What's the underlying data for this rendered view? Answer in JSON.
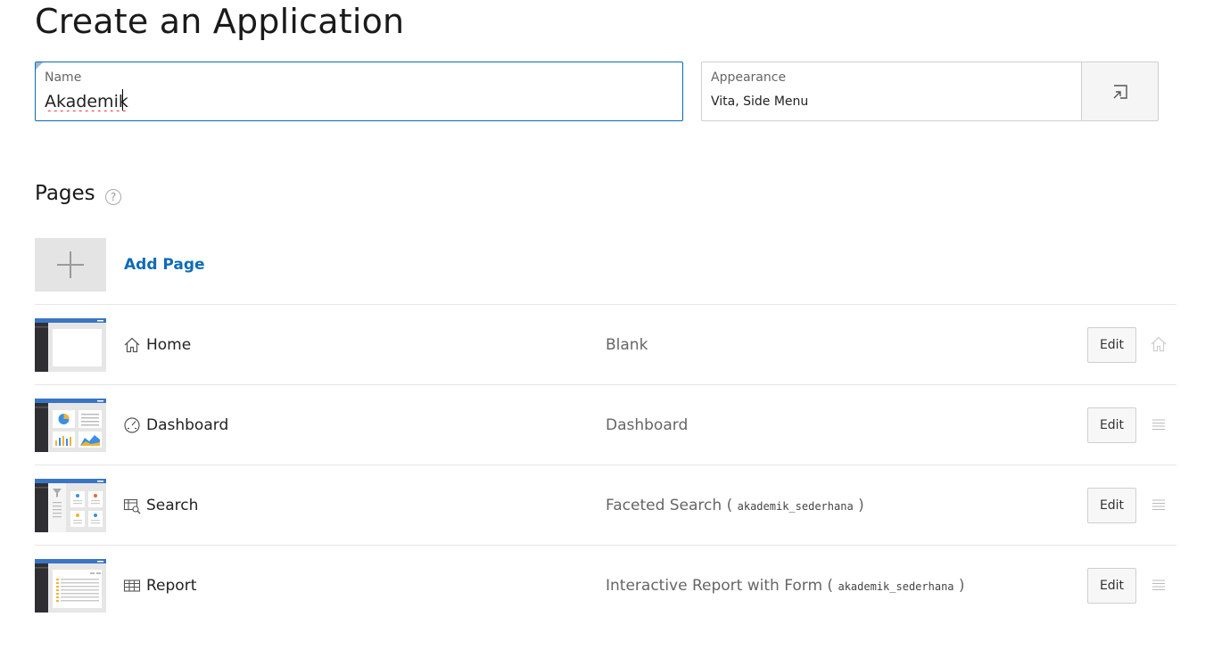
{
  "page": {
    "title": "Create an Application"
  },
  "name_field": {
    "label": "Name",
    "value": "Akademik"
  },
  "appearance_field": {
    "label": "Appearance",
    "value": "Vita, Side Menu",
    "button_icon": "popup-select-icon"
  },
  "pages_section": {
    "title": "Pages",
    "help_icon": "question-mark-icon",
    "add_label": "Add Page"
  },
  "pages": [
    {
      "name": "Home",
      "icon": "home-icon",
      "type": "Blank",
      "table": "",
      "edit_label": "Edit",
      "trail_icon": "home-icon"
    },
    {
      "name": "Dashboard",
      "icon": "dashboard-gauge-icon",
      "type": "Dashboard",
      "table": "",
      "edit_label": "Edit",
      "trail_icon": "drag-handle-icon"
    },
    {
      "name": "Search",
      "icon": "faceted-search-icon",
      "type": "Faceted Search",
      "table": "akademik_sederhana",
      "edit_label": "Edit",
      "trail_icon": "drag-handle-icon"
    },
    {
      "name": "Report",
      "icon": "table-icon",
      "type": "Interactive Report with Form",
      "table": "akademik_sederhana",
      "edit_label": "Edit",
      "trail_icon": "drag-handle-icon"
    }
  ],
  "colors": {
    "accent": "#0f6bb7",
    "thumb_header": "#3a75c4",
    "thumb_sidebar": "#2f2f33",
    "focus_border": "#0b6ab0"
  }
}
